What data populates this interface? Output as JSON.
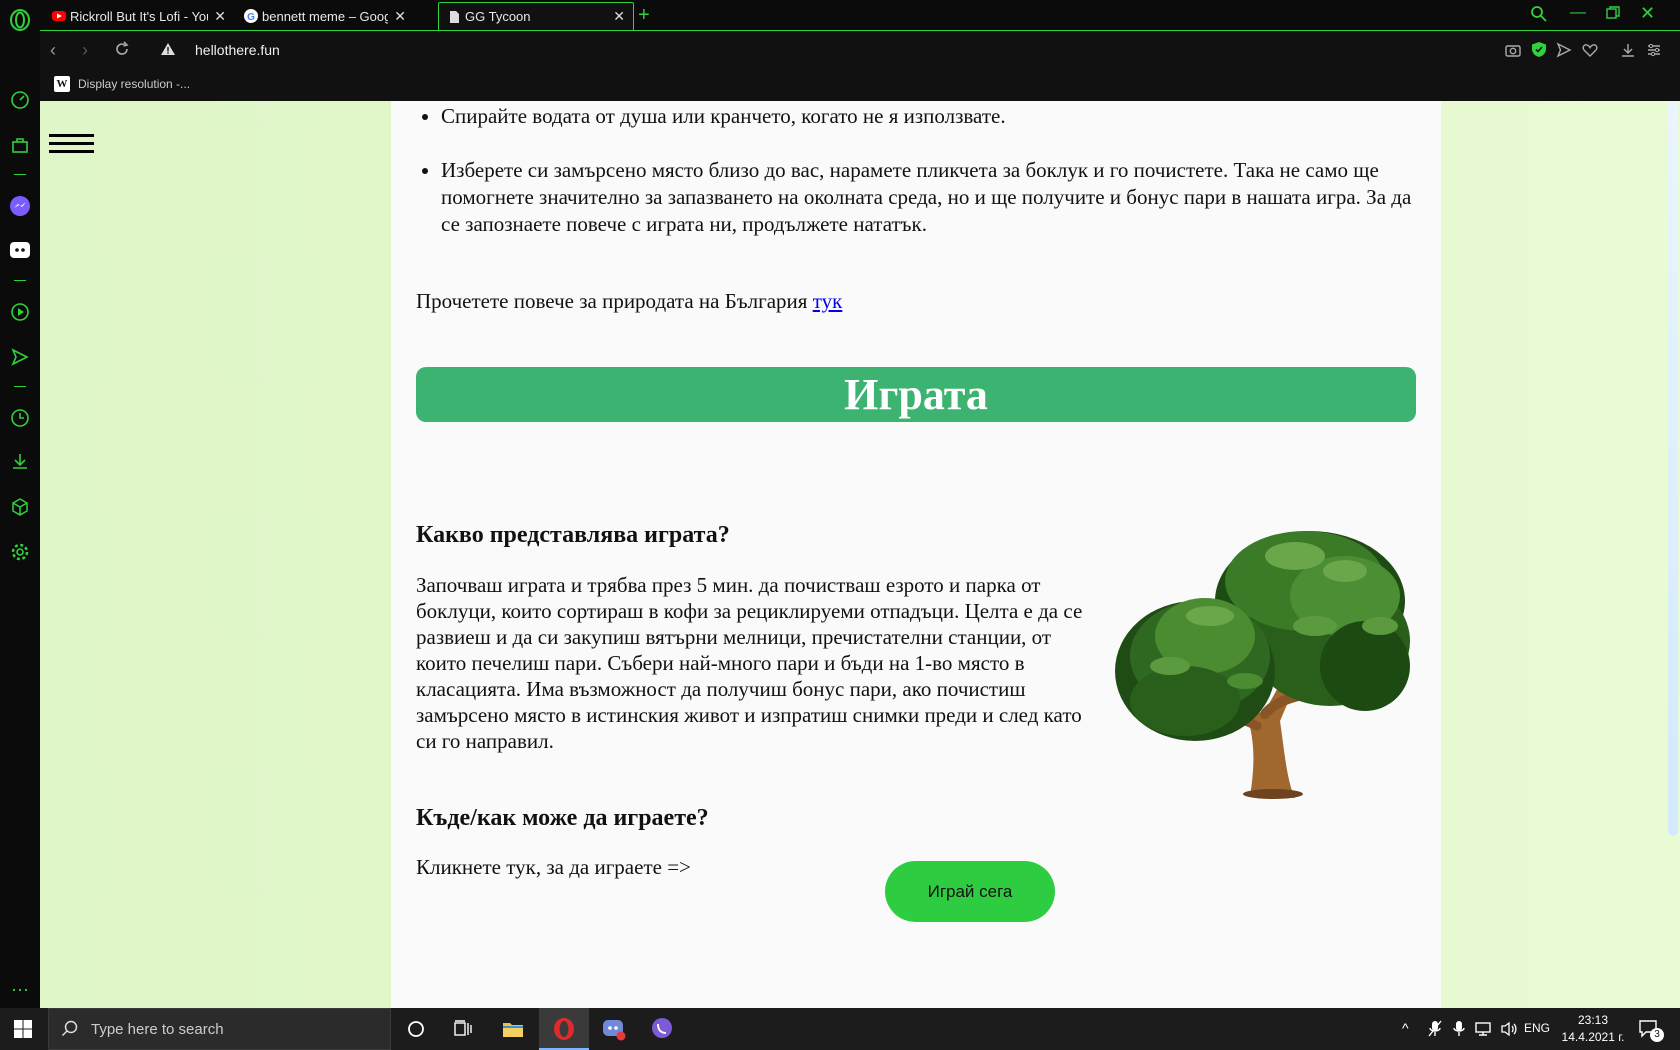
{
  "browser": {
    "tabs": [
      {
        "title": "Rickroll But It's Lofi - YouTu"
      },
      {
        "title": "bennett meme – Google Tr"
      },
      {
        "title": "GG Tycoon"
      }
    ],
    "address": "hellothere.fun",
    "bookmark": "Display resolution -..."
  },
  "page": {
    "bullet1": "Спирайте водата от душа или кранчето, когато не я използвате.",
    "bullet2": "Изберете си замърсено място близо до вас, нарамете пликчета за боклук и го почистете. Така не само ще помогнете значително за запазването на околната среда, но и ще получите и бонус пари в нашата игра. За да се запознаете повече с играта ни, продължете нататък.",
    "read_more_text": "Прочетете повече за природата на България",
    "read_more_link": "тук",
    "banner": "Играта",
    "h_what": "Какво представлява играта?",
    "p_what": "Започваш играта и трябва през 5 мин. да почистваш езрото и парка от боклуци, които сортираш в кофи за рециклируеми отпадъци. Целта е да се развиеш и да си закупиш вятърни мелници, пречистателни станции, от които печелиш пари. Събери най-много пари и бъди на 1-во място в класацията. Има възможност да получиш бонус пари, ако почистиш замърсено място в истинския живот и изпратиш снимки преди и след като си го направил.",
    "h_where": "Къде/как може да играете?",
    "p_where": "Кликнете тук, за да играете =>",
    "play_button": "Играй сега"
  },
  "taskbar": {
    "search_placeholder": "Type here to search",
    "lang": "ENG",
    "time": "23:13",
    "date": "14.4.2021 г.",
    "notifications": "3"
  },
  "colors": {
    "opera_green": "#2fd13c",
    "banner_green": "#3cb371",
    "play_green": "#2ecc40"
  }
}
